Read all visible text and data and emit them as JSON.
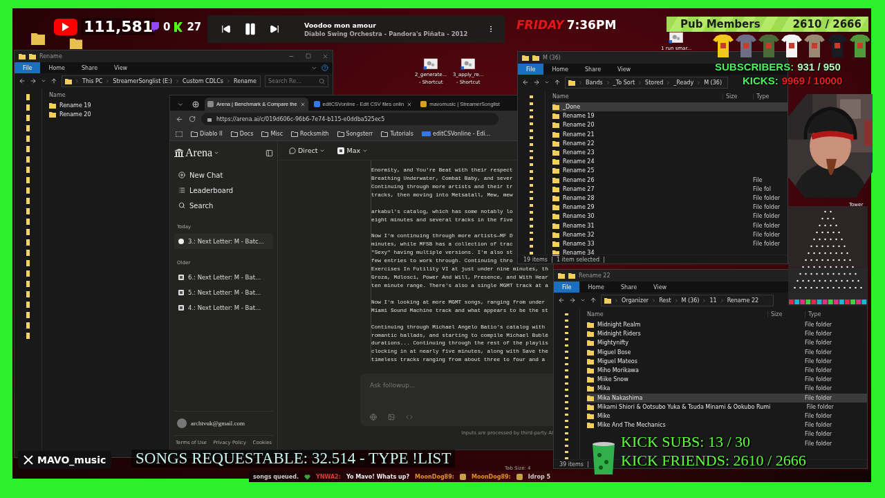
{
  "top_overlay": {
    "youtube_count": "111,581",
    "twitch_count": "0",
    "kick_count": "27",
    "day": "FRIDAY",
    "time": "7:36PM"
  },
  "music_player": {
    "title": "Voodoo mon amour",
    "subtitle": "Diablo Swing Orchestra - Pandora's Piñata - 2012",
    "playing": true
  },
  "pub_members": {
    "label": "Pub Members",
    "count": "2610 / 2666"
  },
  "subscribers": {
    "label": "SUBSCRIBERS:",
    "count": "931 / 950"
  },
  "kicks": {
    "label": "KICKS:",
    "count": "9969 / 10000"
  },
  "desktop_icons": [
    {
      "lines": [
        "2_generate...",
        "- Shortcut"
      ]
    },
    {
      "lines": [
        "3_apply_re...",
        "- Shortcut"
      ]
    },
    {
      "lines": [
        "1 run smar..."
      ]
    },
    {
      "lines": [
        "Tower"
      ]
    }
  ],
  "explorer_rename": {
    "title": "Rename",
    "ribbon_tabs": [
      {
        "label": "File",
        "selected": true
      },
      {
        "label": "Home",
        "selected": false
      },
      {
        "label": "Share",
        "selected": false
      },
      {
        "label": "View",
        "selected": false
      }
    ],
    "path": [
      "This PC",
      "StreamerSonglist (E:)",
      "Custom CDLCs",
      "Rename"
    ],
    "search": {
      "placeholder": "Search Re..."
    },
    "columns": [
      "Name"
    ],
    "rows": [
      {
        "name": "Rename 19",
        "selected": false
      },
      {
        "name": "Rename 20",
        "selected": false
      }
    ]
  },
  "browser": {
    "tabs": [
      {
        "label": "Arena | Benchmark & Compare the",
        "selected": true
      },
      {
        "label": "editCSVonline - Edit CSV files onlin",
        "selected": false
      },
      {
        "label": "mavomusic | StreamerSonglist",
        "selected": false
      }
    ],
    "url": "https://arena.ai/c/019d606c-96b6-7e74-b115-e0ddba525ec5",
    "bookmarks": [
      {
        "label": "Diablo II",
        "kind": "folder"
      },
      {
        "label": "Docs",
        "kind": "folder"
      },
      {
        "label": "Misc",
        "kind": "folder"
      },
      {
        "label": "Rocksmith",
        "kind": "folder"
      },
      {
        "label": "Songsterr",
        "kind": "folder"
      },
      {
        "label": "Tutorials",
        "kind": "folder"
      },
      {
        "label": "editCSVonline - Edi...",
        "kind": "site"
      }
    ],
    "arena": {
      "logo": "Arena",
      "nav": [
        "New Chat",
        "Leaderboard",
        "Search"
      ],
      "sections": [
        {
          "heading": "Today",
          "chats": [
            {
              "title": "3.: Next Letter: M - Batc...",
              "selected": true
            }
          ]
        },
        {
          "heading": "Older",
          "chats": [
            {
              "title": "6.: Next Letter: M - Bat...",
              "selected": false
            },
            {
              "title": "5.: Next Letter: M - Bat...",
              "selected": false
            },
            {
              "title": "4.: Next Letter: M - Bat...",
              "selected": false
            }
          ]
        }
      ],
      "account": "archtvuk@gmail.com",
      "footer_links": [
        "Terms of Use",
        "Privacy Policy",
        "Cookies"
      ],
      "mode": "Direct",
      "model": "Max",
      "response": [
        [
          "Enormity, and You're Beat with their respect",
          "Breathing Underwater, Combat Baby, and sever",
          "Continuing through more artists and their tr",
          "tracks, then moving into Metsatall, Mew, mew"
        ],
        [
          "arkabul's catalog, which has some notably lo",
          "eight minutes and several tracks in the five"
        ],
        [
          "Now I'm continuing through more artists—MF D",
          "minutes, while MFSB has a collection of trac",
          "\"Sexy\" having multiple versions. I'm also st",
          "few entries to work through. Continuing thro",
          "Exercises In Futility VI at just under nine minutes, th",
          "Groza, Mdlosci, Power And Will, Presence, and With Hear",
          "ten minute range. There's also a single MGMT track at a"
        ],
        [
          "Now I'm looking at more MGMT songs, ranging from under",
          "Miami Sound Machine track and what appears to be the st"
        ],
        [
          "Continuing through Michael Angelo Batio's catalog with",
          "romantic ballads, and starting to compile Michael Bublé",
          "durations... Continuing through the rest of the playlis",
          "clocking in at nearly five minutes, along with Save the",
          "timeless tracks ranging from about three to four and a"
        ]
      ],
      "input": {
        "placeholder": "Ask followup..."
      },
      "disclaimer": "Inputs are processed by third-party AI"
    }
  },
  "explorer_m36": {
    "title": "M (36)",
    "ribbon_tabs": [
      {
        "label": "File",
        "selected": true
      },
      {
        "label": "Home",
        "selected": false
      },
      {
        "label": "Share",
        "selected": false
      },
      {
        "label": "View",
        "selected": false
      }
    ],
    "path": [
      "Bands",
      "_To Sort",
      "Stored",
      "_Ready",
      "M (36)"
    ],
    "columns": [
      "Name",
      "Size",
      "Type"
    ],
    "rows": [
      {
        "name": "_Done",
        "selected": true
      },
      {
        "name": "Rename 19",
        "selected": false
      },
      {
        "name": "Rename 20",
        "selected": false
      },
      {
        "name": "Rename 21",
        "selected": false
      },
      {
        "name": "Rename 22",
        "selected": false
      },
      {
        "name": "Rename 23",
        "selected": false
      },
      {
        "name": "Rename 24",
        "selected": false
      },
      {
        "name": "Rename 25",
        "selected": false
      },
      {
        "name": "Rename 26",
        "type": "File",
        "selected": false
      },
      {
        "name": "Rename 27",
        "type": "File fol",
        "selected": false
      },
      {
        "name": "Rename 28",
        "type": "File folder",
        "selected": false
      },
      {
        "name": "Rename 29",
        "type": "File folder",
        "selected": false
      },
      {
        "name": "Rename 30",
        "type": "File folder",
        "selected": false
      },
      {
        "name": "Rename 31",
        "type": "File folder",
        "selected": false
      },
      {
        "name": "Rename 32",
        "type": "File folder",
        "selected": false
      },
      {
        "name": "Rename 33",
        "type": "File folder",
        "selected": false
      },
      {
        "name": "Rename 34",
        "selected": false
      }
    ],
    "status": [
      "19 items",
      "1 item selected"
    ]
  },
  "explorer_rename22": {
    "title": "Rename 22",
    "ribbon_tabs": [
      {
        "label": "File",
        "selected": true
      },
      {
        "label": "Home",
        "selected": false
      },
      {
        "label": "Share",
        "selected": false
      },
      {
        "label": "View",
        "selected": false
      }
    ],
    "path": [
      "Organizer",
      "Rest",
      "M (36)",
      "11",
      "Rename 22"
    ],
    "columns": [
      "Name",
      "Size",
      "Type"
    ],
    "rows": [
      {
        "name": "Midnight Realm",
        "type": "File folder",
        "selected": false
      },
      {
        "name": "Midnight Riders",
        "type": "File folder",
        "selected": false
      },
      {
        "name": "Mightynifty",
        "type": "File folder",
        "selected": false
      },
      {
        "name": "Miguel Bose",
        "type": "File folder",
        "selected": false
      },
      {
        "name": "Miguel Mateos",
        "type": "File folder",
        "selected": false
      },
      {
        "name": "Miho Morikawa",
        "type": "File folder",
        "selected": false
      },
      {
        "name": "Miike Snow",
        "type": "File folder",
        "selected": false
      },
      {
        "name": "Mika",
        "type": "File folder",
        "selected": false
      },
      {
        "name": "Mika Nakashima",
        "type": "File folder",
        "selected": true
      },
      {
        "name": "Mikami Shiori & Ootsubo Yuka & Tsuda Minami & Ookubo Rumi",
        "type": "File folder",
        "selected": false
      },
      {
        "name": "Mike",
        "type": "File folder",
        "selected": false
      },
      {
        "name": "Mike And The Mechanics",
        "type": "File folder",
        "selected": false
      },
      {
        "type": "File folder",
        "selected": false
      },
      {
        "type": "File folder",
        "selected": false
      }
    ],
    "status": [
      "39 items"
    ]
  },
  "bottom_overlay": {
    "handle": "MAVO_music",
    "songs_banner": "SONGS REQUESTABLE: 32.514 - TYPE !LIST",
    "kick_subs": "KICK SUBS: 13 / 30",
    "kick_friends": "KICK FRIENDS: 2610 / 2666",
    "tab_size": "Tab Size: 4",
    "chat_ticker": [
      {
        "kind": "notice",
        "text": "songs queued."
      },
      {
        "kind": "message",
        "user": "YNWA2:",
        "color": "#e03838",
        "text": "Yo Mavo! Whats up?"
      },
      {
        "kind": "message",
        "user": "MoonDog89:",
        "color": "#e0902a"
      },
      {
        "kind": "message",
        "user": "MoonDog89:",
        "color": "#e0902a"
      },
      {
        "kind": "notice",
        "text": "Idrop 5"
      }
    ]
  }
}
